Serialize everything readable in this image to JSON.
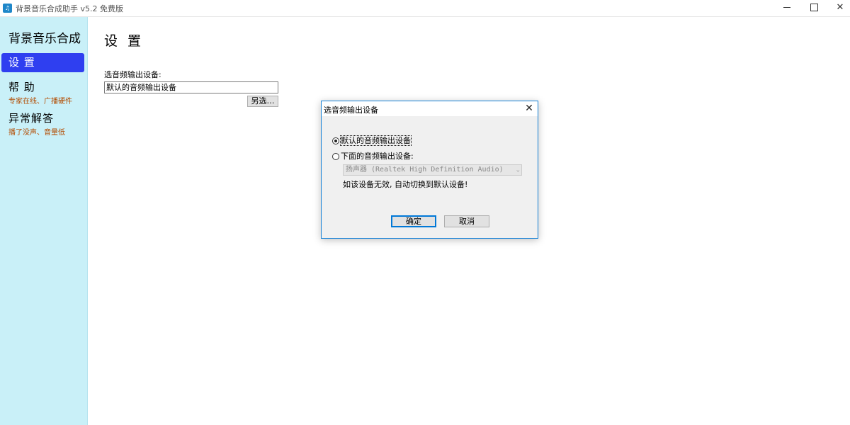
{
  "window": {
    "title": "背景音乐合成助手 v5.2 免费版",
    "icon_text": "𝅘𝅥𝅮",
    "minimize_icon": "minimize-icon",
    "maximize_icon": "maximize-icon",
    "close_symbol": "✕"
  },
  "sidebar": {
    "title": "背景音乐合成",
    "items": [
      {
        "label": "设 置",
        "sub": "",
        "active": true
      },
      {
        "label": "帮 助",
        "sub": "专家在线、广播硬件"
      },
      {
        "label": "异常解答",
        "sub": "播了没声、音量低"
      }
    ]
  },
  "main": {
    "title": "设 置",
    "device_label": "选音频输出设备:",
    "device_value": "默认的音频输出设备",
    "browse_label": "另选…"
  },
  "dialog": {
    "title": "选音频输出设备",
    "close_symbol": "✕",
    "option_default": "默认的音频输出设备",
    "option_custom": "下面的音频输出设备:",
    "selected_device": "扬声器 (Realtek High Definition Audio)",
    "select_arrow": "⌄",
    "hint": "如该设备无效, 自动切换到默认设备!",
    "ok_label": "确定",
    "cancel_label": "取消"
  },
  "colors": {
    "sidebar_bg": "#c9f0f8",
    "active_item_bg": "#2f3ff0",
    "sub_text": "#b34b00",
    "dialog_border": "#1883d7"
  }
}
